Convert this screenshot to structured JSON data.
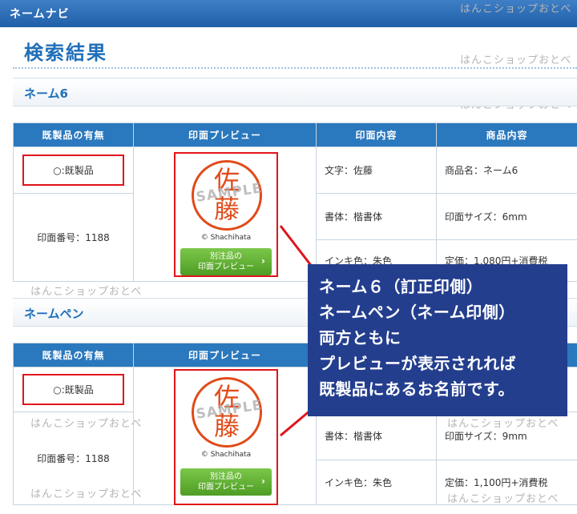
{
  "header": {
    "title": "ネームナビ"
  },
  "watermark": "はんこショップおとべ",
  "page_title": "検索結果",
  "columns": [
    "既製品の有無",
    "印面プレビュー",
    "印面内容",
    "商品内容"
  ],
  "sections": [
    {
      "title": "ネーム6",
      "availability": "○:既製品",
      "stamp_number": "印面番号：1188",
      "stamp_chars": [
        "佐",
        "藤"
      ],
      "stamp_overlay": "SAMPLE",
      "brand": "© Shachihata",
      "preview_button": [
        "別注品の",
        "印面プレビュー"
      ],
      "details": [
        {
          "content": "文字：佐藤",
          "product": "商品名：ネーム6"
        },
        {
          "content": "書体：楷書体",
          "product": "印面サイズ：6mm"
        },
        {
          "content": "インキ色：朱色",
          "product": "定価：1,080円+消費税"
        }
      ]
    },
    {
      "title": "ネームペン",
      "availability": "○:既製品",
      "stamp_number": "印面番号：1188",
      "stamp_chars": [
        "佐",
        "藤"
      ],
      "stamp_overlay": "SAMPLE",
      "brand": "© Shachihata",
      "preview_button": [
        "別注品の",
        "印面プレビュー"
      ],
      "details": [
        {
          "content": "",
          "product": ""
        },
        {
          "content": "書体：楷書体",
          "product": "印面サイズ：9mm"
        },
        {
          "content": "インキ色：朱色",
          "product": "定価：1,100円+消費税"
        }
      ]
    }
  ],
  "callout": [
    "ネーム６（訂正印側）",
    "ネームペン（ネーム印側）",
    "両方ともに",
    "プレビューが表示されれば",
    "既製品にあるお名前です。"
  ],
  "colors": {
    "header_blue": "#1f5fa8",
    "highlight_red": "#e0141a",
    "callout_navy": "#243e8e",
    "button_green": "#5aab2e"
  }
}
